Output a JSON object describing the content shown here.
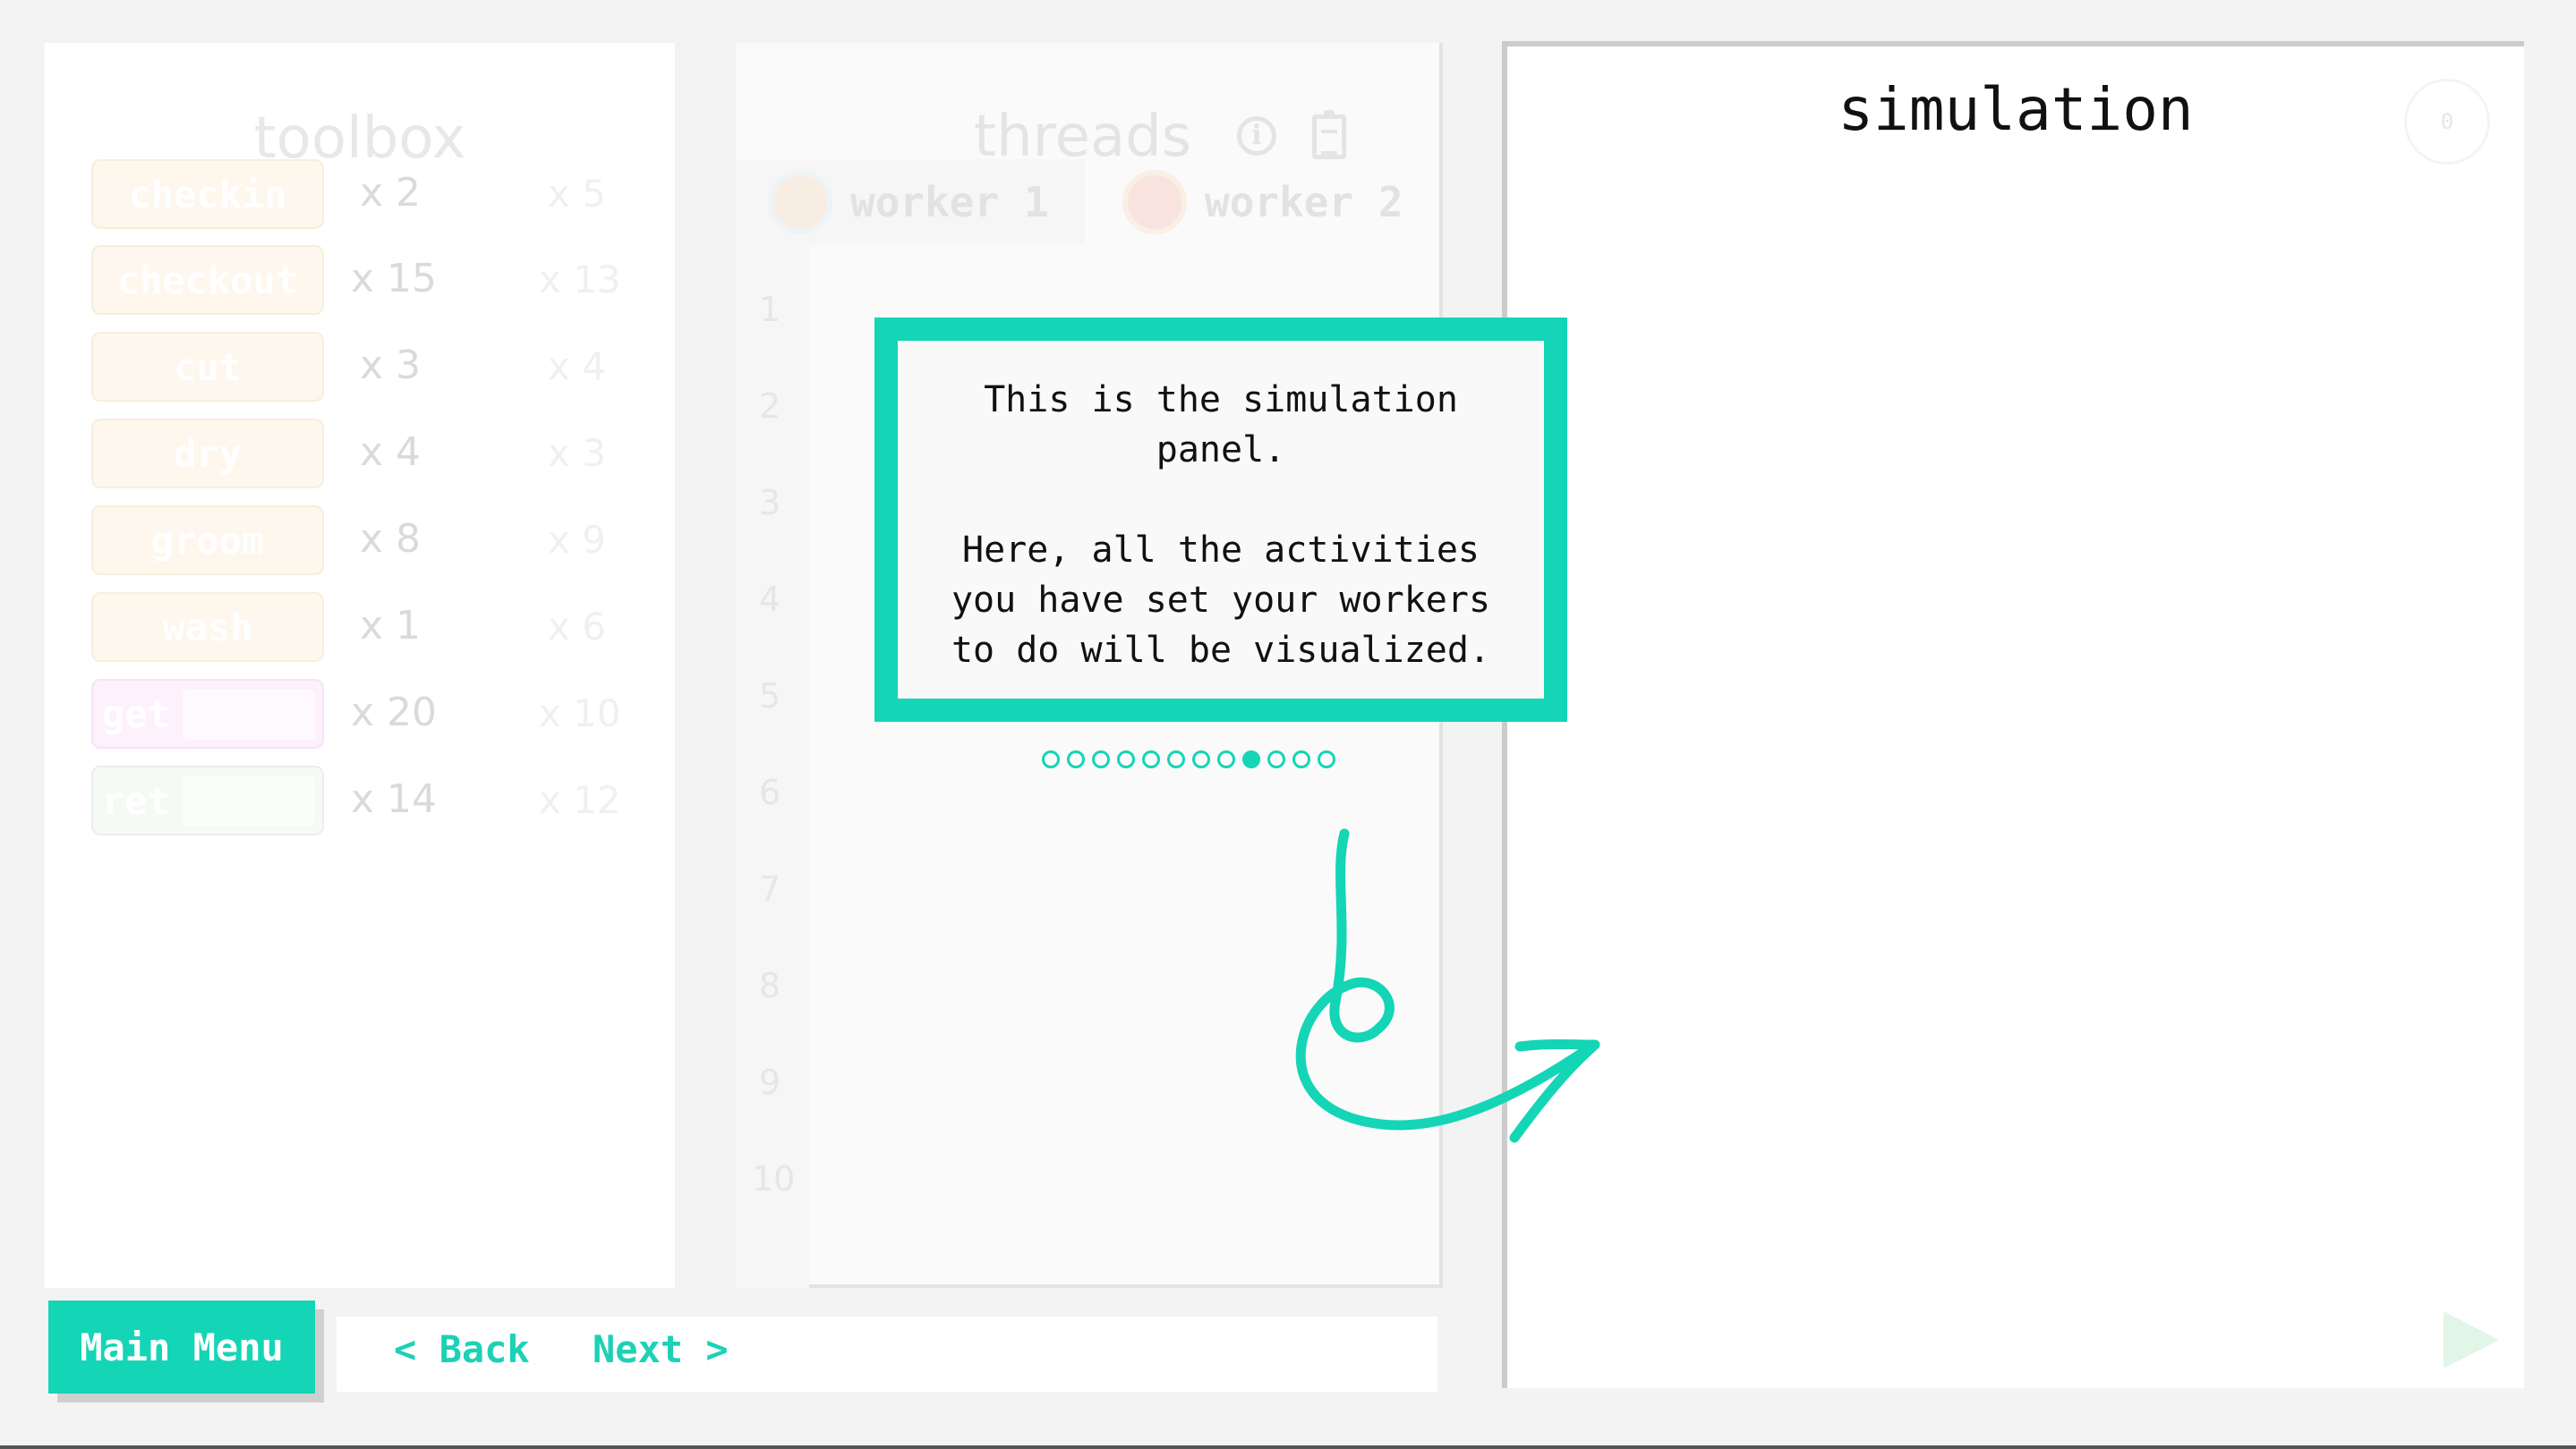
{
  "toolbox": {
    "title": "toolbox",
    "items": [
      {
        "label": "checkin",
        "count": "x 2",
        "max": "x 5"
      },
      {
        "label": "checkout",
        "count": "x 15",
        "max": "x 13"
      },
      {
        "label": "cut",
        "count": "x 3",
        "max": "x 4"
      },
      {
        "label": "dry",
        "count": "x 4",
        "max": "x 3"
      },
      {
        "label": "groom",
        "count": "x 8",
        "max": "x 9"
      },
      {
        "label": "wash",
        "count": "x 1",
        "max": "x 6"
      },
      {
        "label": "get",
        "count": "x 20",
        "max": "x 10"
      },
      {
        "label": "ret",
        "count": "x 14",
        "max": "x 12"
      }
    ]
  },
  "threads": {
    "title": "threads",
    "tabs": [
      {
        "label": "worker 1"
      },
      {
        "label": "worker 2"
      }
    ],
    "line_numbers": [
      "1",
      "2",
      "3",
      "4",
      "5",
      "6",
      "7",
      "8",
      "9",
      "10"
    ]
  },
  "simulation": {
    "title": "simulation",
    "counter": "0"
  },
  "nav": {
    "main_menu": "Main Menu",
    "back": "< Back",
    "next": "Next >"
  },
  "tutorial": {
    "message": "This is the simulation\npanel.\n\nHere, all the activities\nyou have set your workers\nto do will be visualized.",
    "step_count": 12,
    "active_step": 9,
    "accent_color": "#14d5b6"
  },
  "icons": [
    "info-icon",
    "clipboard-icon",
    "play-icon",
    "avatar-icon",
    "curved-arrow-icon"
  ]
}
